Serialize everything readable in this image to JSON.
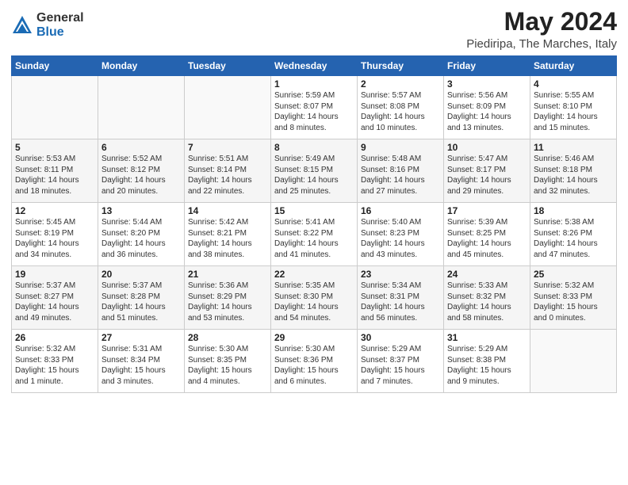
{
  "header": {
    "logo_general": "General",
    "logo_blue": "Blue",
    "title": "May 2024",
    "subtitle": "Piediripa, The Marches, Italy"
  },
  "calendar": {
    "days_of_week": [
      "Sunday",
      "Monday",
      "Tuesday",
      "Wednesday",
      "Thursday",
      "Friday",
      "Saturday"
    ],
    "weeks": [
      [
        {
          "num": "",
          "info": ""
        },
        {
          "num": "",
          "info": ""
        },
        {
          "num": "",
          "info": ""
        },
        {
          "num": "1",
          "info": "Sunrise: 5:59 AM\nSunset: 8:07 PM\nDaylight: 14 hours\nand 8 minutes."
        },
        {
          "num": "2",
          "info": "Sunrise: 5:57 AM\nSunset: 8:08 PM\nDaylight: 14 hours\nand 10 minutes."
        },
        {
          "num": "3",
          "info": "Sunrise: 5:56 AM\nSunset: 8:09 PM\nDaylight: 14 hours\nand 13 minutes."
        },
        {
          "num": "4",
          "info": "Sunrise: 5:55 AM\nSunset: 8:10 PM\nDaylight: 14 hours\nand 15 minutes."
        }
      ],
      [
        {
          "num": "5",
          "info": "Sunrise: 5:53 AM\nSunset: 8:11 PM\nDaylight: 14 hours\nand 18 minutes."
        },
        {
          "num": "6",
          "info": "Sunrise: 5:52 AM\nSunset: 8:12 PM\nDaylight: 14 hours\nand 20 minutes."
        },
        {
          "num": "7",
          "info": "Sunrise: 5:51 AM\nSunset: 8:14 PM\nDaylight: 14 hours\nand 22 minutes."
        },
        {
          "num": "8",
          "info": "Sunrise: 5:49 AM\nSunset: 8:15 PM\nDaylight: 14 hours\nand 25 minutes."
        },
        {
          "num": "9",
          "info": "Sunrise: 5:48 AM\nSunset: 8:16 PM\nDaylight: 14 hours\nand 27 minutes."
        },
        {
          "num": "10",
          "info": "Sunrise: 5:47 AM\nSunset: 8:17 PM\nDaylight: 14 hours\nand 29 minutes."
        },
        {
          "num": "11",
          "info": "Sunrise: 5:46 AM\nSunset: 8:18 PM\nDaylight: 14 hours\nand 32 minutes."
        }
      ],
      [
        {
          "num": "12",
          "info": "Sunrise: 5:45 AM\nSunset: 8:19 PM\nDaylight: 14 hours\nand 34 minutes."
        },
        {
          "num": "13",
          "info": "Sunrise: 5:44 AM\nSunset: 8:20 PM\nDaylight: 14 hours\nand 36 minutes."
        },
        {
          "num": "14",
          "info": "Sunrise: 5:42 AM\nSunset: 8:21 PM\nDaylight: 14 hours\nand 38 minutes."
        },
        {
          "num": "15",
          "info": "Sunrise: 5:41 AM\nSunset: 8:22 PM\nDaylight: 14 hours\nand 41 minutes."
        },
        {
          "num": "16",
          "info": "Sunrise: 5:40 AM\nSunset: 8:23 PM\nDaylight: 14 hours\nand 43 minutes."
        },
        {
          "num": "17",
          "info": "Sunrise: 5:39 AM\nSunset: 8:25 PM\nDaylight: 14 hours\nand 45 minutes."
        },
        {
          "num": "18",
          "info": "Sunrise: 5:38 AM\nSunset: 8:26 PM\nDaylight: 14 hours\nand 47 minutes."
        }
      ],
      [
        {
          "num": "19",
          "info": "Sunrise: 5:37 AM\nSunset: 8:27 PM\nDaylight: 14 hours\nand 49 minutes."
        },
        {
          "num": "20",
          "info": "Sunrise: 5:37 AM\nSunset: 8:28 PM\nDaylight: 14 hours\nand 51 minutes."
        },
        {
          "num": "21",
          "info": "Sunrise: 5:36 AM\nSunset: 8:29 PM\nDaylight: 14 hours\nand 53 minutes."
        },
        {
          "num": "22",
          "info": "Sunrise: 5:35 AM\nSunset: 8:30 PM\nDaylight: 14 hours\nand 54 minutes."
        },
        {
          "num": "23",
          "info": "Sunrise: 5:34 AM\nSunset: 8:31 PM\nDaylight: 14 hours\nand 56 minutes."
        },
        {
          "num": "24",
          "info": "Sunrise: 5:33 AM\nSunset: 8:32 PM\nDaylight: 14 hours\nand 58 minutes."
        },
        {
          "num": "25",
          "info": "Sunrise: 5:32 AM\nSunset: 8:33 PM\nDaylight: 15 hours\nand 0 minutes."
        }
      ],
      [
        {
          "num": "26",
          "info": "Sunrise: 5:32 AM\nSunset: 8:33 PM\nDaylight: 15 hours\nand 1 minute."
        },
        {
          "num": "27",
          "info": "Sunrise: 5:31 AM\nSunset: 8:34 PM\nDaylight: 15 hours\nand 3 minutes."
        },
        {
          "num": "28",
          "info": "Sunrise: 5:30 AM\nSunset: 8:35 PM\nDaylight: 15 hours\nand 4 minutes."
        },
        {
          "num": "29",
          "info": "Sunrise: 5:30 AM\nSunset: 8:36 PM\nDaylight: 15 hours\nand 6 minutes."
        },
        {
          "num": "30",
          "info": "Sunrise: 5:29 AM\nSunset: 8:37 PM\nDaylight: 15 hours\nand 7 minutes."
        },
        {
          "num": "31",
          "info": "Sunrise: 5:29 AM\nSunset: 8:38 PM\nDaylight: 15 hours\nand 9 minutes."
        },
        {
          "num": "",
          "info": ""
        }
      ]
    ]
  }
}
